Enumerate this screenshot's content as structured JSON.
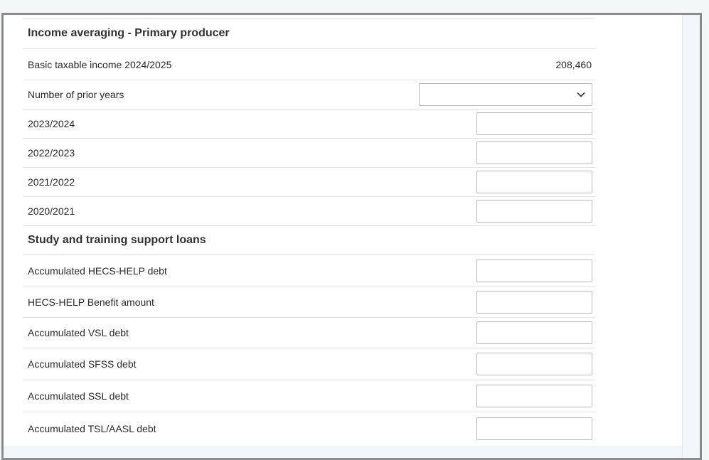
{
  "income_averaging": {
    "heading": "Income averaging - Primary producer",
    "basic_taxable_label": "Basic taxable income 2024/2025",
    "basic_taxable_value": "208,460",
    "prior_years_label": "Number of prior years",
    "prior_years_value": "",
    "years": [
      {
        "label": "2023/2024",
        "value": ""
      },
      {
        "label": "2022/2023",
        "value": ""
      },
      {
        "label": "2021/2022",
        "value": ""
      },
      {
        "label": "2020/2021",
        "value": ""
      }
    ]
  },
  "study_loans": {
    "heading": "Study and training support loans",
    "fields": [
      {
        "label": "Accumulated HECS-HELP debt",
        "value": ""
      },
      {
        "label": "HECS-HELP Benefit amount",
        "value": ""
      },
      {
        "label": "Accumulated VSL debt",
        "value": ""
      },
      {
        "label": "Accumulated SFSS debt",
        "value": ""
      },
      {
        "label": "Accumulated SSL debt",
        "value": ""
      },
      {
        "label": "Accumulated TSL/AASL debt",
        "value": ""
      }
    ]
  },
  "icons": {
    "select_arrow": "chevron-down-icon"
  }
}
